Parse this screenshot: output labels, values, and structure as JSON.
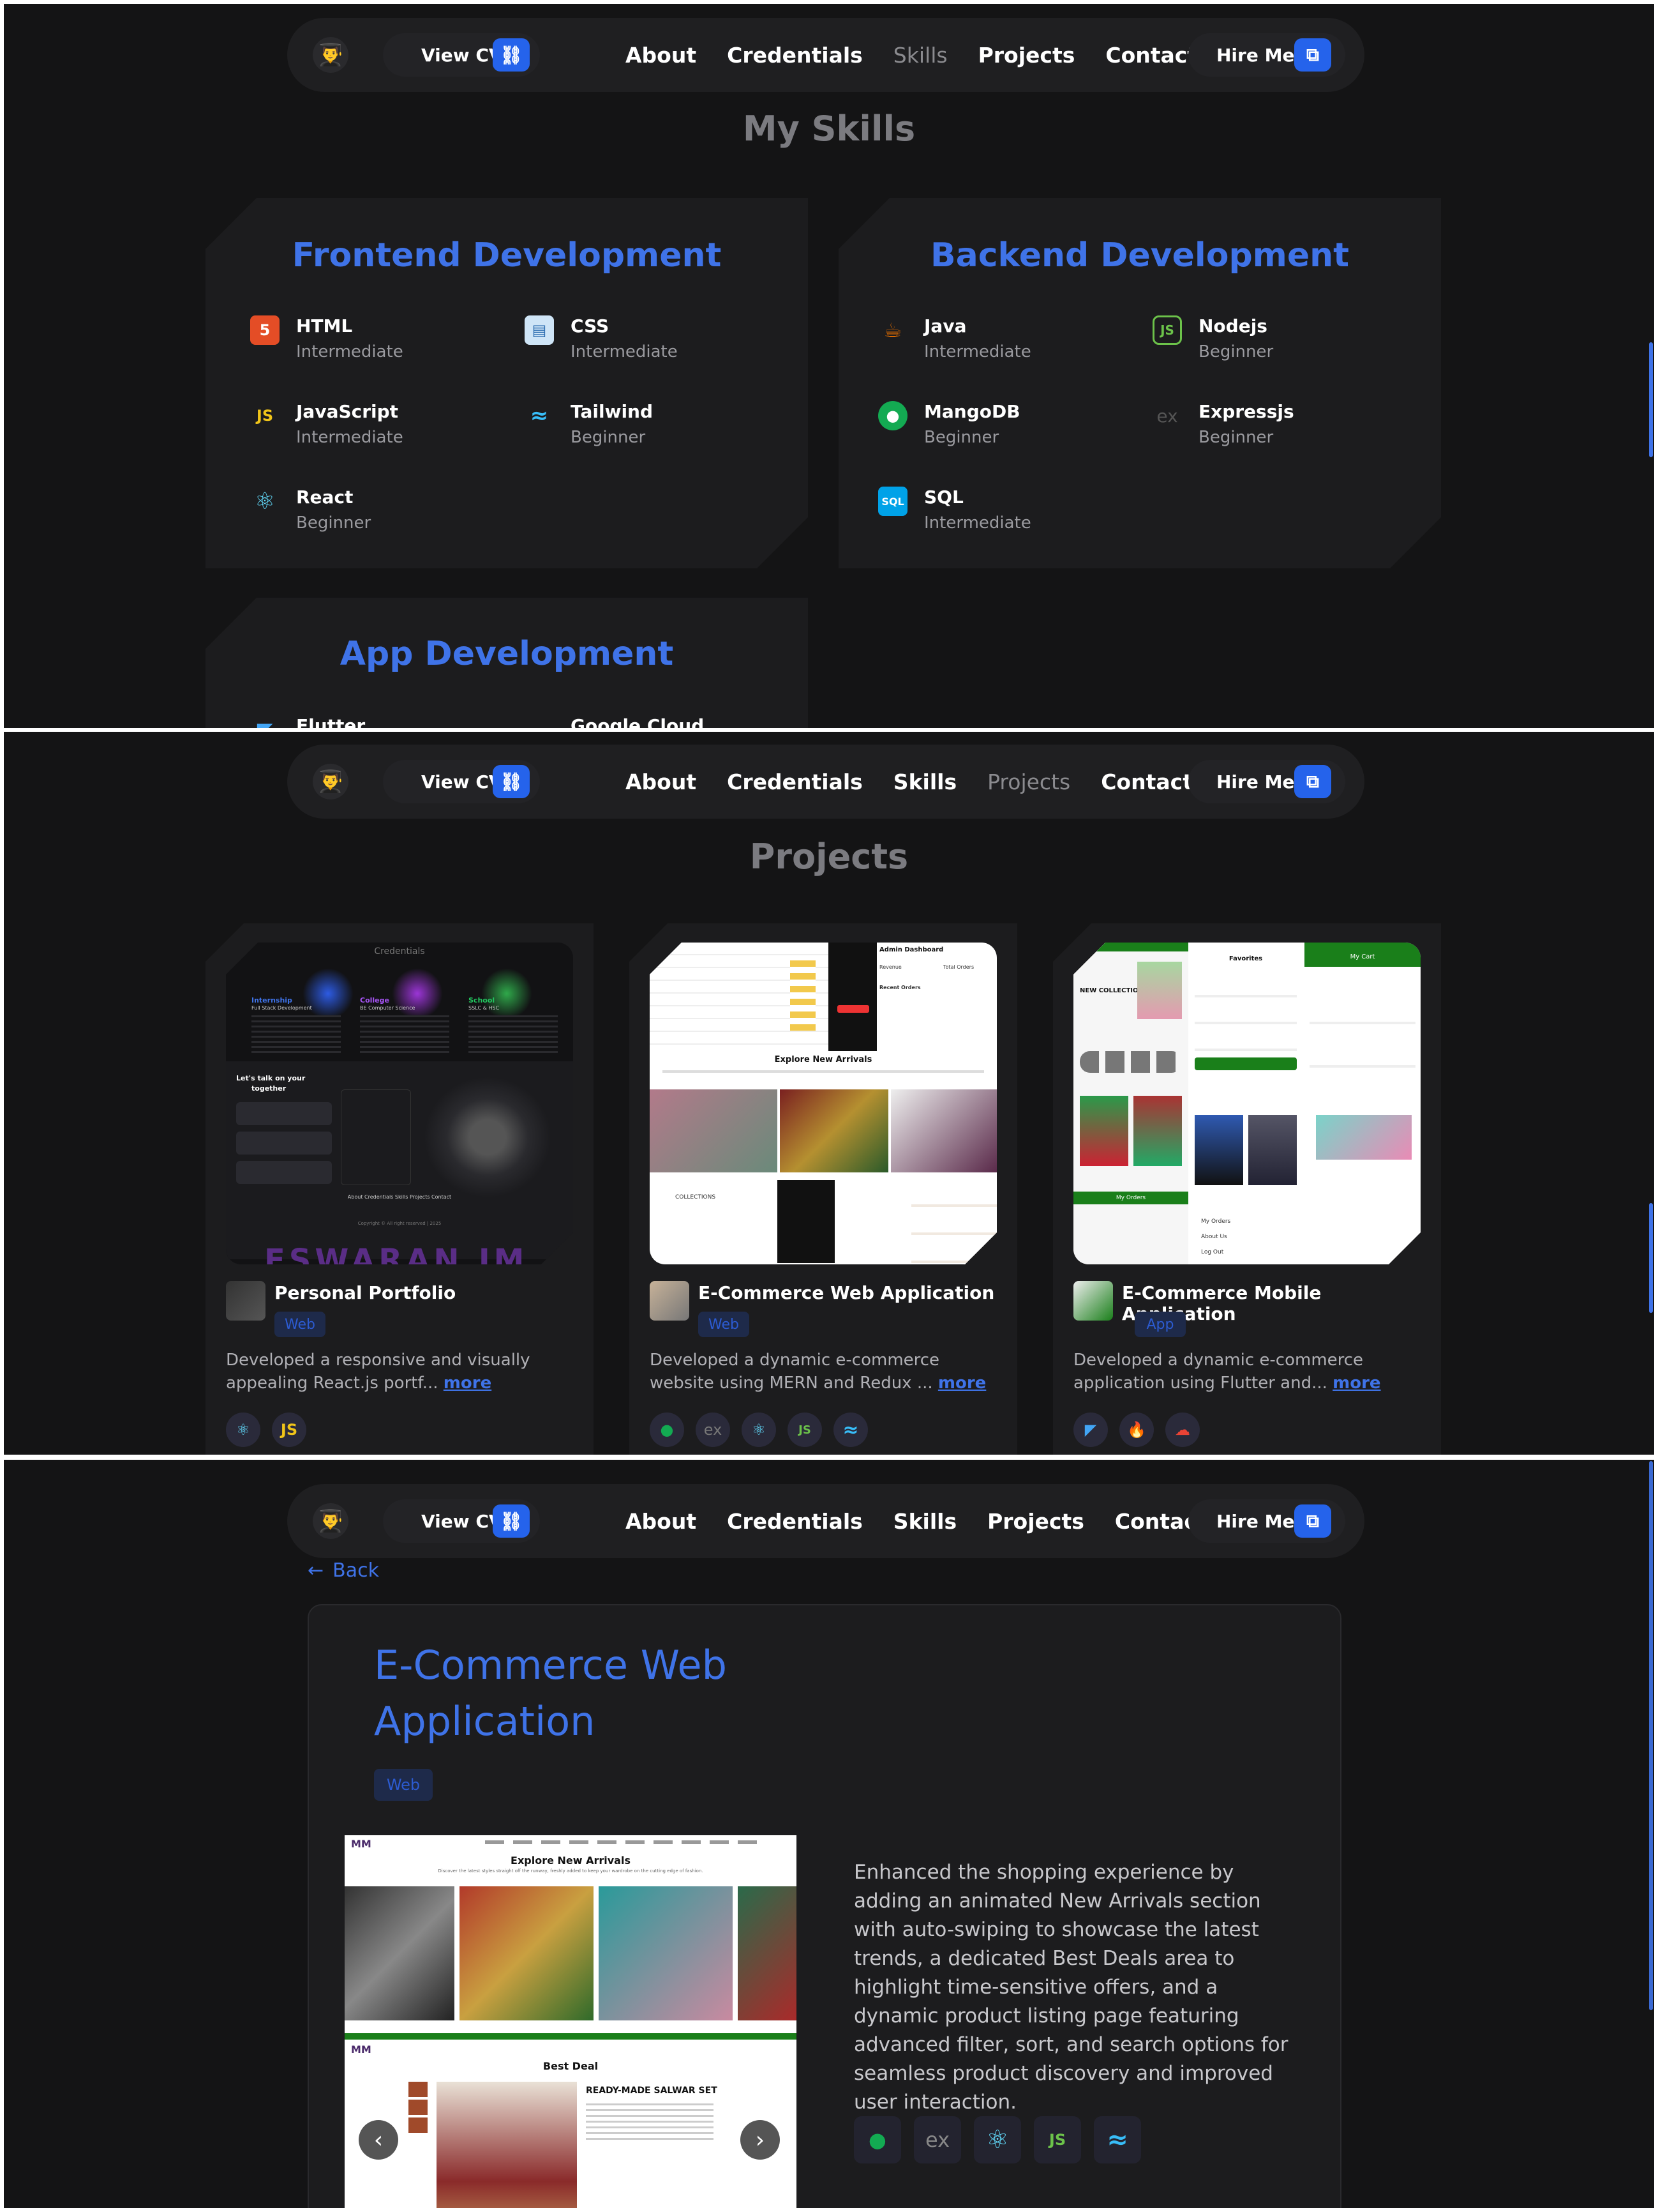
{
  "nav": {
    "avatar_icon": "avatar-icon",
    "view_cv": "View CV",
    "links": [
      "About",
      "Credentials",
      "Skills",
      "Projects",
      "Contact"
    ],
    "hire_me": "Hire Me"
  },
  "skills_section": {
    "title": "My Skills",
    "categories": [
      {
        "title": "Frontend Development",
        "items": [
          {
            "name": "HTML",
            "level": "Intermediate",
            "icon": "html5-icon",
            "color": "#e44d26"
          },
          {
            "name": "CSS",
            "level": "Intermediate",
            "icon": "css-icon",
            "color": "#5aa0d8"
          },
          {
            "name": "JavaScript",
            "level": "Intermediate",
            "icon": "javascript-icon",
            "color": "#f0c419"
          },
          {
            "name": "Tailwind",
            "level": "Beginner",
            "icon": "tailwind-icon",
            "color": "#38bdf8"
          },
          {
            "name": "React",
            "level": "Beginner",
            "icon": "react-icon",
            "color": "#61dafb"
          }
        ]
      },
      {
        "title": "Backend Development",
        "items": [
          {
            "name": "Java",
            "level": "Intermediate",
            "icon": "java-icon",
            "color": "#e76f00"
          },
          {
            "name": "Nodejs",
            "level": "Beginner",
            "icon": "nodejs-icon",
            "color": "#6cc24a"
          },
          {
            "name": "MangoDB",
            "level": "Beginner",
            "icon": "mongodb-icon",
            "color": "#13aa52"
          },
          {
            "name": "Expressjs",
            "level": "Beginner",
            "icon": "express-icon",
            "color": "#555555"
          },
          {
            "name": "SQL",
            "level": "Intermediate",
            "icon": "sql-icon",
            "color": "#00a2e8"
          }
        ]
      },
      {
        "title": "App Development",
        "items": [
          {
            "name": "Flutter",
            "level": "",
            "icon": "flutter-icon",
            "color": "#42a5f5"
          },
          {
            "name": "Google Cloud",
            "level": "",
            "icon": "google-cloud-icon",
            "color": "#ea4335"
          }
        ]
      }
    ]
  },
  "projects_section": {
    "title": "Projects",
    "projects": [
      {
        "title": "Personal Portfolio",
        "tag": "Web",
        "desc": "Developed a responsive and visually appealing React.js portf...",
        "more": "more",
        "techs": [
          {
            "label": "⚛",
            "icon": "react-icon",
            "color": "#61dafb"
          },
          {
            "label": "JS",
            "icon": "javascript-icon",
            "color": "#f0c419"
          }
        ]
      },
      {
        "title": "E-Commerce Web Application",
        "tag": "Web",
        "desc": "Developed a dynamic e-commerce website using MERN and Redux ...",
        "more": "more",
        "techs": [
          {
            "label": "●",
            "icon": "mongodb-icon",
            "color": "#13aa52"
          },
          {
            "label": "ex",
            "icon": "express-icon",
            "color": "#777777"
          },
          {
            "label": "⚛",
            "icon": "react-icon",
            "color": "#61dafb"
          },
          {
            "label": "JS",
            "icon": "nodejs-icon",
            "color": "#6cc24a"
          },
          {
            "label": "≈",
            "icon": "tailwind-icon",
            "color": "#38bdf8"
          }
        ]
      },
      {
        "title": "E-Commerce Mobile Application",
        "tag": "App",
        "desc": "Developed a dynamic e-commerce application using Flutter and...",
        "more": "more",
        "techs": [
          {
            "label": "◤",
            "icon": "flutter-icon",
            "color": "#42a5f5"
          },
          {
            "label": "🔥",
            "icon": "firebase-icon",
            "color": "#ffa000"
          },
          {
            "label": "☁",
            "icon": "google-cloud-icon",
            "color": "#ea4335"
          }
        ]
      }
    ],
    "shot1": {
      "heading": "Credentials",
      "cols": [
        {
          "t": "Internship",
          "s": "Full Stack Development"
        },
        {
          "t": "College",
          "s": "BE Computer Science"
        },
        {
          "t": "School",
          "s": "SSLC & HSC"
        }
      ],
      "talk": "Let's talk on your",
      "talk2": "together",
      "footer": "About  Credentials  Skills  Projects  Contact",
      "copyright": "Copyright © All right reserved | 2025",
      "big": "ESWARAN.JM"
    },
    "shot2": {
      "admin": "Admin Dashboard",
      "revenue": "Revenue",
      "total_orders": "Total Orders",
      "recent_orders": "Recent Orders",
      "arrivals": "Explore New Arrivals",
      "collections": "COLLECTIONS"
    },
    "shot3": {
      "favorites": "Favorites",
      "cart": "My Cart",
      "new_collections": "NEW COLLECTIONS",
      "orders": "My Orders",
      "menu": [
        "My Orders",
        "About Us",
        "Log Out"
      ]
    }
  },
  "detail": {
    "back": "Back",
    "title": "E-Commerce Web Application",
    "tag": "Web",
    "description": "Enhanced the shopping experience by adding an animated New Arrivals section with auto-swiping to showcase the latest trends, a dedicated Best Deals area to highlight time-sensitive offers, and a dynamic product listing page featuring advanced filter, sort, and search options for seamless product discovery and improved user interaction.",
    "techs": [
      {
        "label": "●",
        "icon": "mongodb-icon",
        "color": "#13aa52"
      },
      {
        "label": "ex",
        "icon": "express-icon",
        "color": "#888888"
      },
      {
        "label": "⚛",
        "icon": "react-icon",
        "color": "#61dafb"
      },
      {
        "label": "JS",
        "icon": "nodejs-icon",
        "color": "#6cc24a"
      },
      {
        "label": "≈",
        "icon": "tailwind-icon",
        "color": "#38bdf8"
      }
    ],
    "shot": {
      "logo": "MM",
      "arrivals": "Explore New Arrivals",
      "arrivals_sub": "Discover the latest styles straight off the runway, freshly added to keep your wardrobe on the cutting edge of fashion.",
      "best_deal": "Best Deal",
      "product": "READY-MADE SALWAR SET",
      "prev": "‹",
      "next": "›"
    }
  },
  "colors": {
    "accent": "#3f73e8",
    "bg": "#141415",
    "card": "#1c1c1e"
  }
}
